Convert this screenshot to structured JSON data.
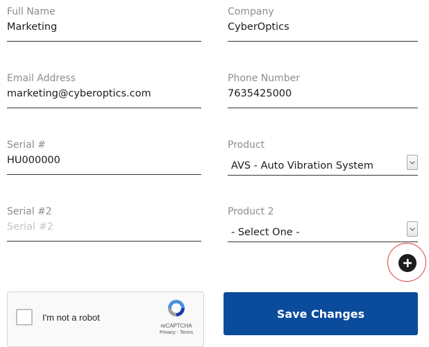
{
  "form": {
    "full_name": {
      "label": "Full Name",
      "value": "Marketing"
    },
    "company": {
      "label": "Company",
      "value": "CyberOptics"
    },
    "email": {
      "label": "Email Address",
      "value": "marketing@cyberoptics.com"
    },
    "phone": {
      "label": "Phone Number",
      "value": "7635425000"
    },
    "serial": {
      "label": "Serial #",
      "value": "HU000000"
    },
    "product": {
      "label": "Product",
      "selected": "AVS - Auto Vibration System"
    },
    "serial2": {
      "label": "Serial #2",
      "placeholder": "Serial #2"
    },
    "product2": {
      "label": "Product 2",
      "selected": "- Select One -"
    },
    "add_icon": "plus-circle-icon"
  },
  "captcha": {
    "checkbox_label": "I'm not a robot",
    "brand": "reCAPTCHA",
    "links": "Privacy - Terms",
    "logo_icon": "recaptcha-logo-icon"
  },
  "actions": {
    "save_label": "Save Changes"
  },
  "colors": {
    "primary": "#0a4b9c",
    "highlight_ring": "#d93b3b",
    "label": "#8c8c8c",
    "placeholder": "#c4c4c4"
  }
}
